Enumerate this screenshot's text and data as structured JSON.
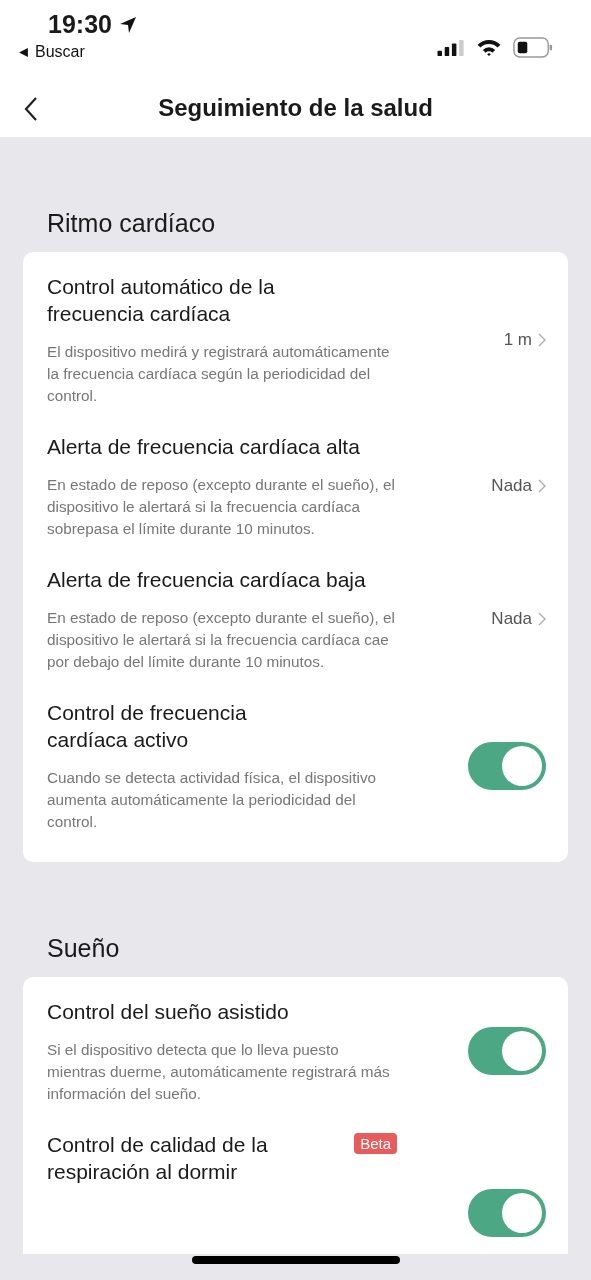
{
  "status_bar": {
    "time": "19:30",
    "back_label": "Buscar"
  },
  "nav": {
    "title": "Seguimiento de la salud"
  },
  "sections": [
    {
      "title": "Ritmo cardíaco",
      "rows": [
        {
          "kind": "value",
          "title": "Control automático de la frecuencia cardíaca",
          "description": "El dispositivo medirá y registrará automáticamente la frecuencia cardíaca según la periodicidad del control.",
          "value": "1 m"
        },
        {
          "kind": "value",
          "title": "Alerta de frecuencia cardíaca alta",
          "description": "En estado de reposo (excepto durante el sueño), el dispositivo le alertará si la frecuencia cardíaca sobrepasa el límite durante 10 minutos.",
          "value": "Nada"
        },
        {
          "kind": "value",
          "title": "Alerta de frecuencia cardíaca baja",
          "description": "En estado de reposo (excepto durante el sueño), el dispositivo le alertará si la frecuencia cardíaca cae por debajo del límite durante 10 minutos.",
          "value": "Nada"
        },
        {
          "kind": "toggle",
          "title": "Control de frecuencia cardíaca activo",
          "description": "Cuando se detecta actividad física, el dispositivo aumenta automáticamente la periodicidad del control.",
          "on": true
        }
      ]
    },
    {
      "title": "Sueño",
      "rows": [
        {
          "kind": "toggle",
          "title": "Control del sueño asistido",
          "description": "Si el dispositivo detecta que lo lleva puesto mientras duerme, automáticamente registrará más información del sueño.",
          "on": true
        },
        {
          "kind": "toggle",
          "title": "Control de calidad de la respiración al dormir",
          "badge": "Beta",
          "on": true
        }
      ]
    }
  ]
}
